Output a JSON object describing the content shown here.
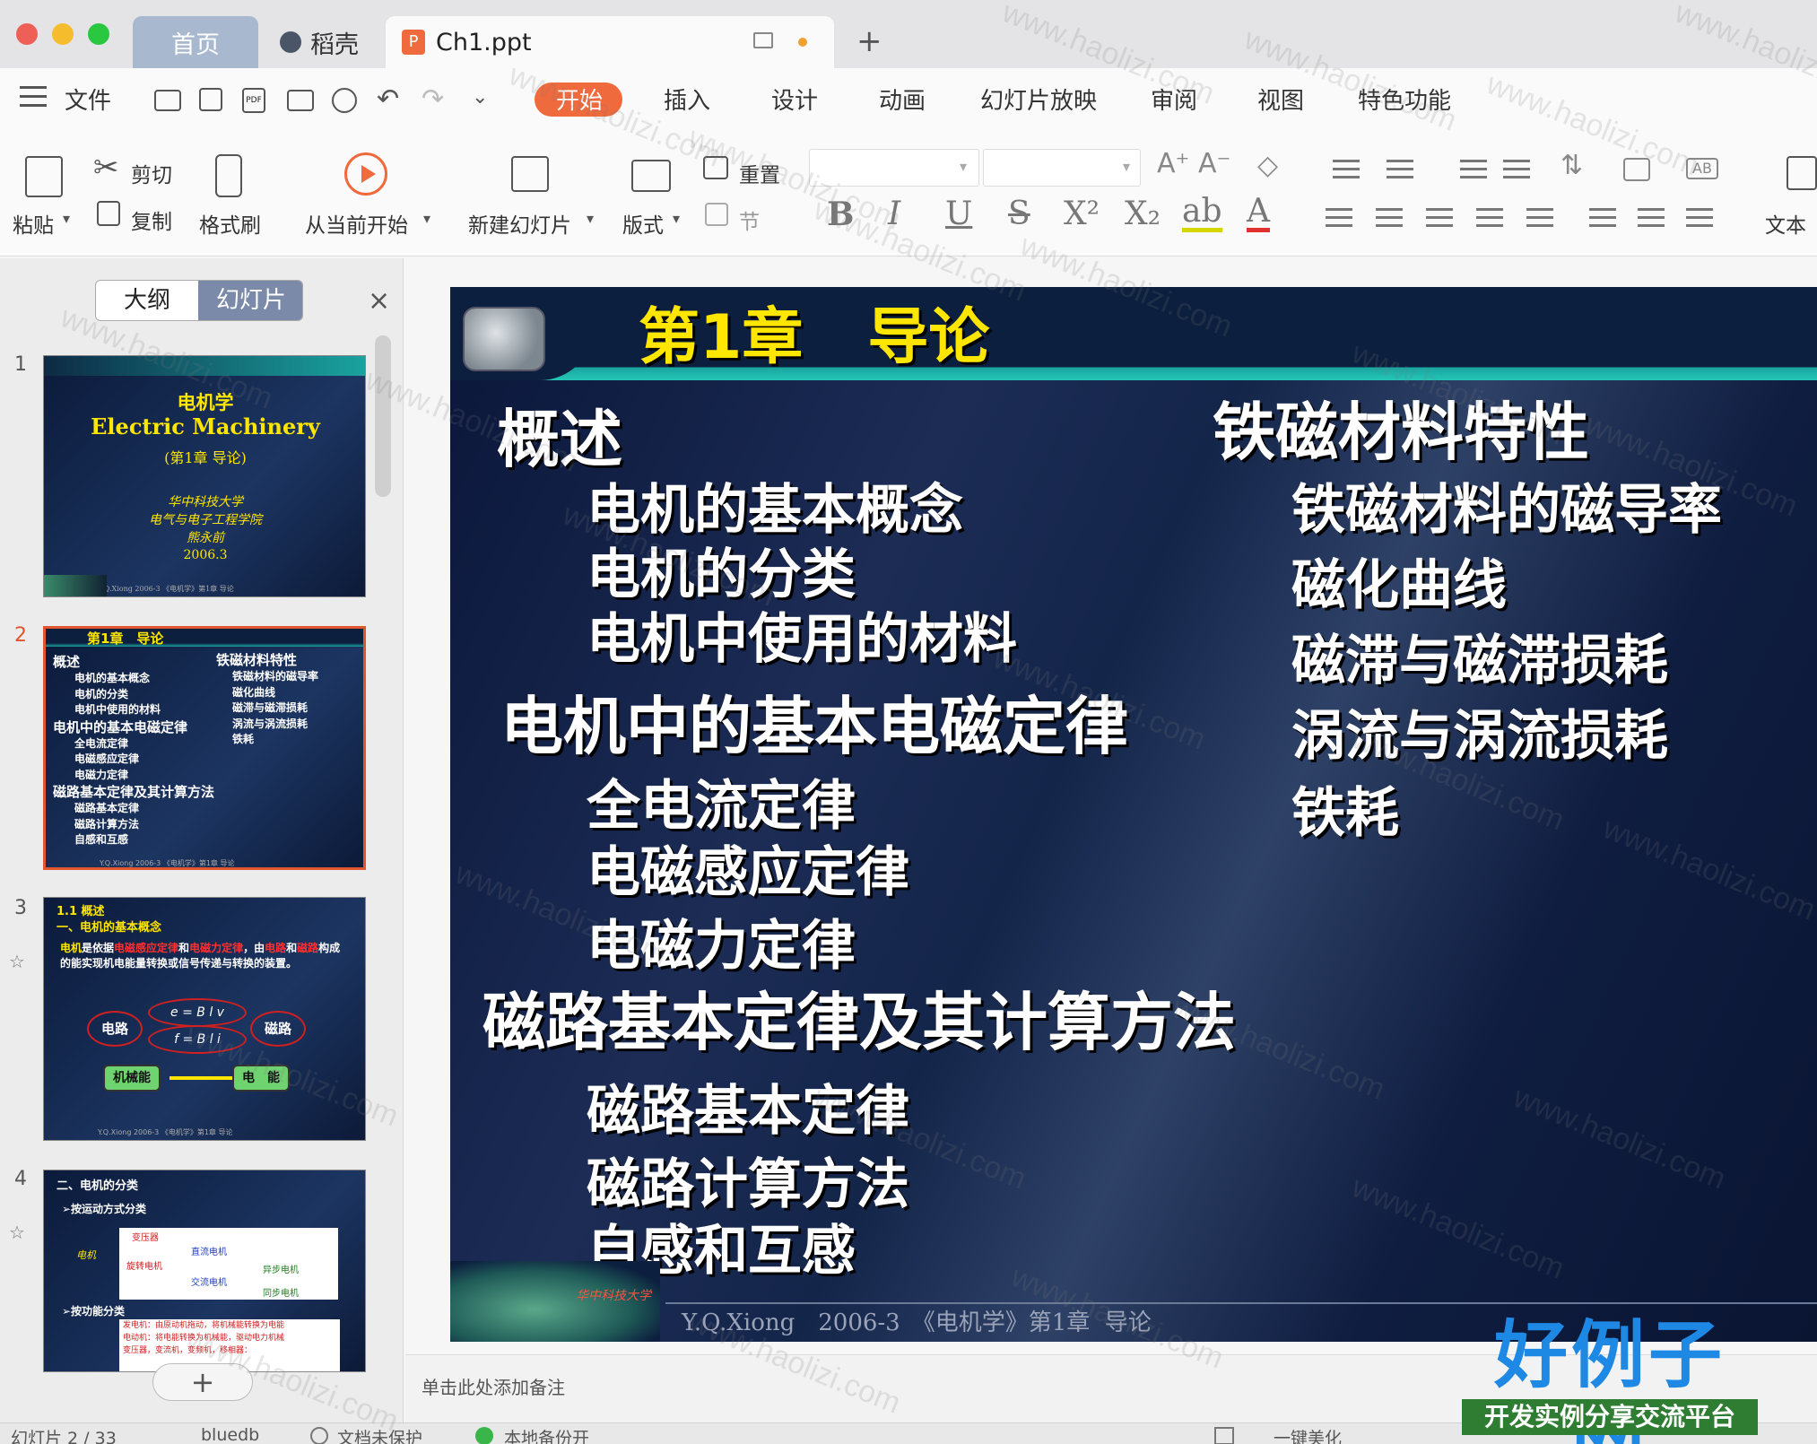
{
  "tabs": {
    "home": "首页",
    "daoke": "稻壳",
    "doc": "Ch1.ppt",
    "add": "+"
  },
  "menu": {
    "hamburger": "≡",
    "file": "文件",
    "items": [
      "开始",
      "插入",
      "设计",
      "动画",
      "幻灯片放映",
      "审阅",
      "视图",
      "特色功能"
    ],
    "active": "开始"
  },
  "ribbon": {
    "paste": "粘贴",
    "cut": "剪切",
    "copy": "复制",
    "format_painter": "格式刷",
    "play_from_current": "从当前开始",
    "new_slide": "新建幻灯片",
    "layout": "版式",
    "reset": "重置",
    "section": "节",
    "text_box": "文本"
  },
  "panel": {
    "outline_tab": "大纲",
    "slides_tab": "幻灯片",
    "close": "×",
    "add": "+"
  },
  "thumbs": {
    "n1": "1",
    "n2": "2",
    "n3": "3",
    "n4": "4",
    "t1": {
      "title": "电机学",
      "subtitle": "Electric Machinery",
      "chapter": "(第1章 导论)",
      "school": "华中科技大学",
      "dept": "电气与电子工程学院",
      "author": "熊永前",
      "date": "2006.3",
      "footer": "Y.Q.Xiong   2006-3   《电机学》第1章 导论"
    },
    "t2": {
      "title": "第1章　导论",
      "left": [
        "概述",
        "电机的基本概念",
        "电机的分类",
        "电机中使用的材料",
        "电机中的基本电磁定律",
        "全电流定律",
        "电磁感应定律",
        "电磁力定律",
        "磁路基本定律及其计算方法",
        "磁路基本定律",
        "磁路计算方法",
        "自感和互感"
      ],
      "right": [
        "铁磁材料特性",
        "铁磁材料的磁导率",
        "磁化曲线",
        "磁滞与磁滞损耗",
        "涡流与涡流损耗",
        "铁耗"
      ],
      "footer": "Y.Q.Xiong   2006-3   《电机学》第1章 导论"
    },
    "t3": {
      "h1": "1.1  概述",
      "h2": "一、电机的基本概念",
      "p1": "电机",
      "p2": "是依据",
      "p3": "电磁感应定律",
      "p4": "和",
      "p5": "电磁力定律",
      "p6": "，由",
      "p7": "电路",
      "p8": "和",
      "p9": "磁路",
      "p10": "构成的能实现机电能量转换或信号传递与转换的装置。",
      "circuit": "电路",
      "magnetic": "磁路",
      "eq1": "e = B l v",
      "eq2": "f = B l i",
      "mech": "机械能",
      "elec": "电　能",
      "footer": "Y.Q.Xiong   2006-3   《电机学》第1章 导论"
    },
    "t4": {
      "h1": "二、电机的分类",
      "b1": "➢按运动方式分类",
      "b2": "➢按功能分类",
      "root": "电机",
      "c1": "变压器",
      "c2": "旋转电机",
      "c3": "直流电机",
      "c4": "交流电机",
      "c5": "异步电机",
      "c6": "同步电机",
      "f1": "发电机：由原动机拖动，将机械能转换为电能",
      "f2": "电动机：将电能转换为机械能，驱动电力机械",
      "f3": "变压器，变流机，变频机，移相器："
    }
  },
  "slide": {
    "title_part1": "第1章",
    "title_part2": "导论",
    "left_items": [
      {
        "text": "概述",
        "level": 1
      },
      {
        "text": "电机的基本概念",
        "level": 2
      },
      {
        "text": "电机的分类",
        "level": 2
      },
      {
        "text": "电机中使用的材料",
        "level": 2
      },
      {
        "text": "电机中的基本电磁定律",
        "level": 1
      },
      {
        "text": "全电流定律",
        "level": 2
      },
      {
        "text": "电磁感应定律",
        "level": 2
      },
      {
        "text": "电磁力定律",
        "level": 2
      },
      {
        "text": "磁路基本定律及其计算方法",
        "level": 1
      },
      {
        "text": "磁路基本定律",
        "level": 2
      },
      {
        "text": "磁路计算方法",
        "level": 2
      },
      {
        "text": "自感和互感",
        "level": 2
      }
    ],
    "right_items": [
      {
        "text": "铁磁材料特性",
        "level": 1
      },
      {
        "text": "铁磁材料的磁导率",
        "level": 2
      },
      {
        "text": "磁化曲线",
        "level": 2
      },
      {
        "text": "磁滞与磁滞损耗",
        "level": 2
      },
      {
        "text": "涡流与涡流损耗",
        "level": 2
      },
      {
        "text": "铁耗",
        "level": 2
      }
    ],
    "footer": "Y.Q.Xiong　2006-3　《电机学》第1章  导论",
    "logo_text": "华中科技大学"
  },
  "notes": {
    "placeholder": "单击此处添加备注"
  },
  "status": {
    "slide_count": "幻灯片 2 / 33",
    "theme": "bluedb",
    "protect": "文档未保护",
    "backup": "本地备份开",
    "beautify": "一键美化"
  },
  "brand": {
    "name": "好例子网",
    "tagline": "开发实例分享交流平台",
    "watermark": "www.haolizi.com"
  },
  "colors": {
    "accent": "#ef6a3c",
    "slide_bg": "#0f1d40",
    "slide_title": "#ffe600",
    "brand": "#1e88e5",
    "selected_border": "#e0562f"
  }
}
